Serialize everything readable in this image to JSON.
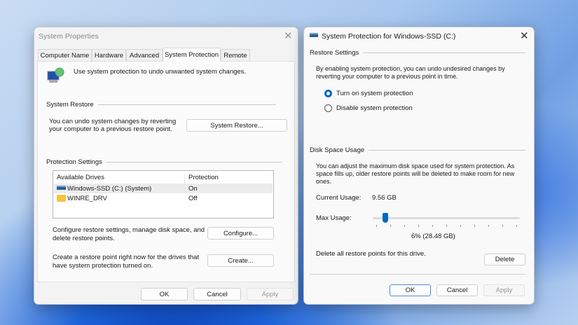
{
  "system_properties": {
    "title": "System Properties",
    "tabs": [
      "Computer Name",
      "Hardware",
      "Advanced",
      "System Protection",
      "Remote"
    ],
    "intro": "Use system protection to undo unwanted system changes.",
    "restore_group": "System Restore",
    "restore_text": "You can undo system changes by reverting your computer to a previous restore point.",
    "restore_button": "System Restore...",
    "protection_group": "Protection Settings",
    "columns": [
      "Available Drives",
      "Protection"
    ],
    "drives": [
      {
        "name": "Windows-SSD (C:) (System)",
        "protection": "On",
        "icon": "drive-icon"
      },
      {
        "name": "WINRE_DRV",
        "protection": "Off",
        "icon": "folder-icon"
      }
    ],
    "configure_text": "Configure restore settings, manage disk space, and delete restore points.",
    "configure_button": "Configure...",
    "create_text": "Create a restore point right now for the drives that have system protection turned on.",
    "create_button": "Create...",
    "ok": "OK",
    "cancel": "Cancel",
    "apply": "Apply"
  },
  "protection_dialog": {
    "title": "System Protection for Windows-SSD (C:)",
    "restore_group": "Restore Settings",
    "restore_text": "By enabling system protection, you can undo undesired changes by reverting your computer to a previous point in time.",
    "options": [
      {
        "label": "Turn on system protection",
        "selected": true
      },
      {
        "label": "Disable system protection",
        "selected": false
      }
    ],
    "disk_group": "Disk Space Usage",
    "disk_text": "You can adjust the maximum disk space used for system protection. As space fills up, older restore points will be deleted to make room for new ones.",
    "current_usage_label": "Current Usage:",
    "current_usage_value": "9.56 GB",
    "max_usage_label": "Max Usage:",
    "max_usage_percent": 6,
    "max_usage_text": "6% (28.48 GB)",
    "delete_text": "Delete all restore points for this drive.",
    "delete_button": "Delete",
    "ok": "OK",
    "cancel": "Cancel",
    "apply": "Apply"
  },
  "colors": {
    "accent": "#0067c0"
  }
}
